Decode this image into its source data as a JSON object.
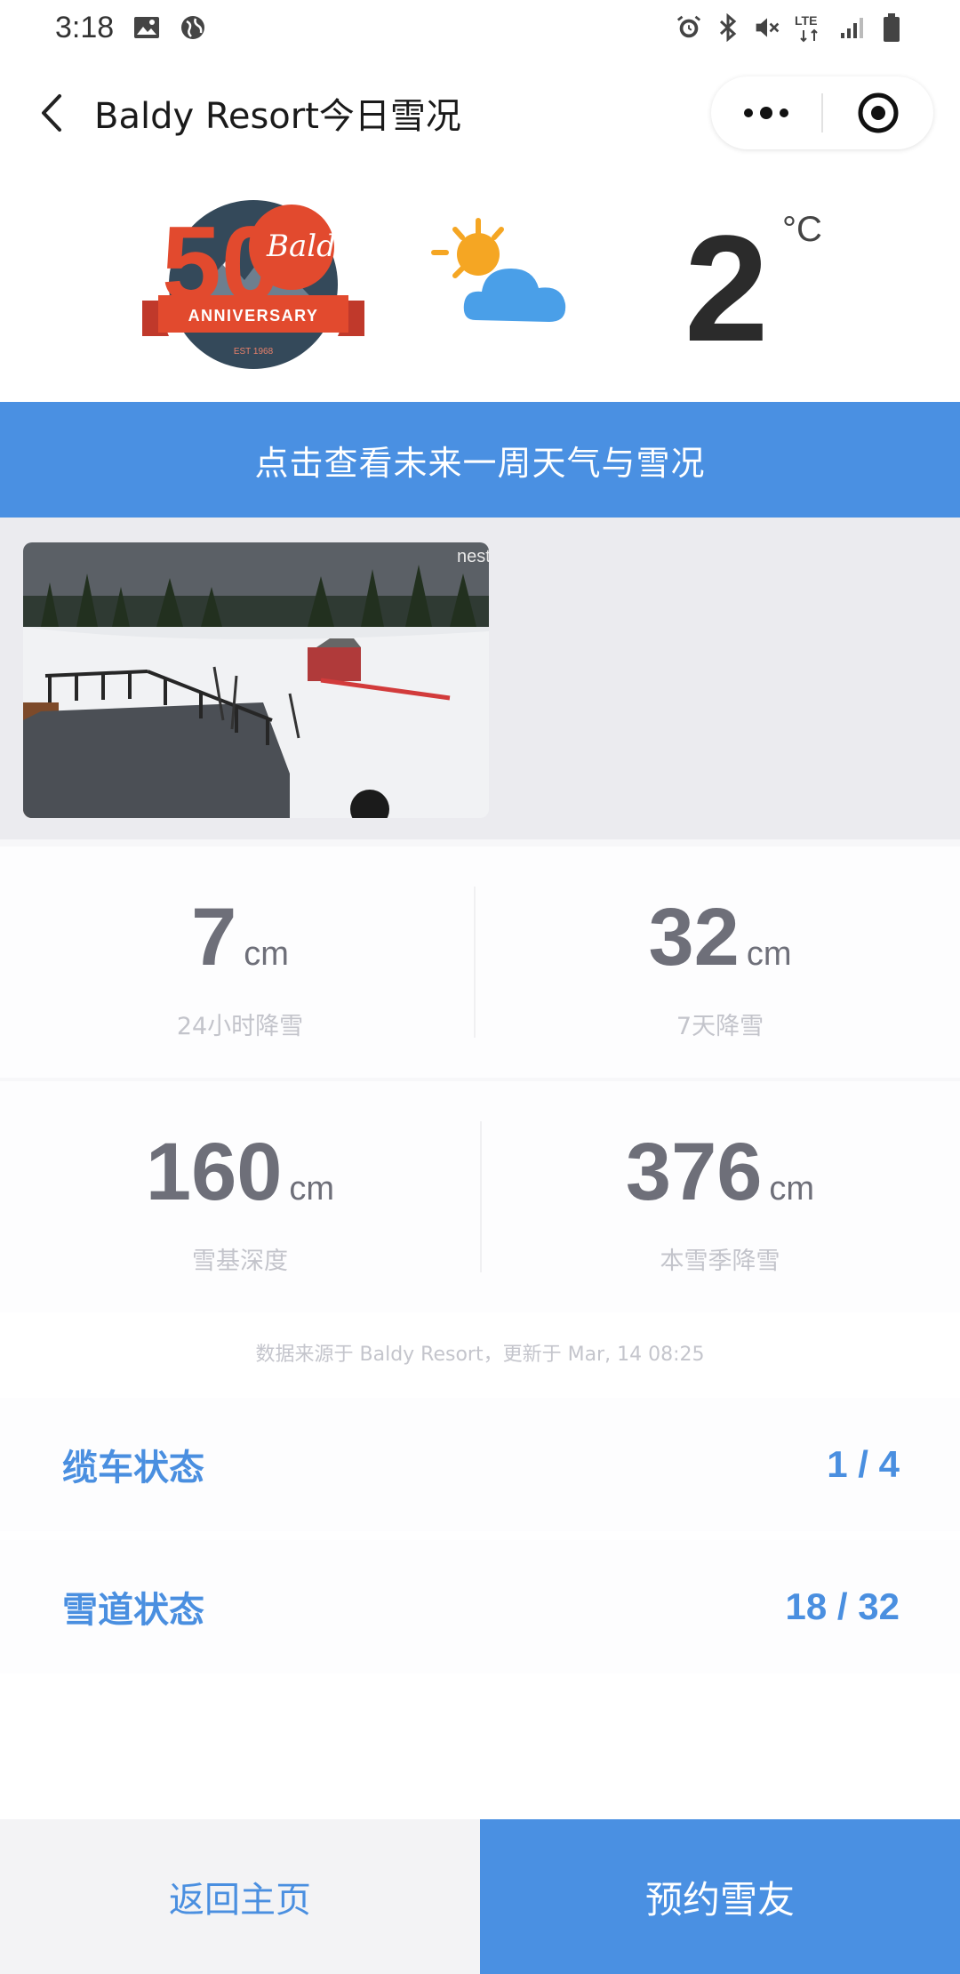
{
  "status_bar": {
    "time": "3:18",
    "network": "LTE",
    "icons": [
      "image-icon",
      "globe-icon",
      "alarm-icon",
      "bluetooth-icon",
      "mute-icon",
      "lte-icon",
      "signal-icon",
      "battery-icon"
    ]
  },
  "nav": {
    "title": "Baldy Resort今日雪况"
  },
  "weather": {
    "logo_text": "Baldy",
    "logo_banner": "ANNIVERSARY",
    "logo_est": "EST 1968",
    "logo_number": "50",
    "temperature": "2",
    "unit": "°C",
    "condition_icon": "partly-cloudy-icon"
  },
  "banner": {
    "label": "点击查看未来一周天气与雪况"
  },
  "webcam": {
    "watermark": "nest"
  },
  "stats": [
    {
      "value": "7",
      "unit": "cm",
      "label": "24小时降雪"
    },
    {
      "value": "32",
      "unit": "cm",
      "label": "7天降雪"
    },
    {
      "value": "160",
      "unit": "cm",
      "label": "雪基深度"
    },
    {
      "value": "376",
      "unit": "cm",
      "label": "本雪季降雪"
    }
  ],
  "source_note": "数据来源于 Baldy Resort，更新于 Mar, 14 08:25",
  "lift_status": {
    "label": "缆车状态",
    "value": "1 / 4"
  },
  "trail_status": {
    "label": "雪道状态",
    "value": "18 / 32"
  },
  "bottom": {
    "home_label": "返回主页",
    "book_label": "预约雪友"
  },
  "colors": {
    "accent": "#4a90e2",
    "stat_text": "#6e6f79",
    "label_text": "#c3c4cb"
  }
}
